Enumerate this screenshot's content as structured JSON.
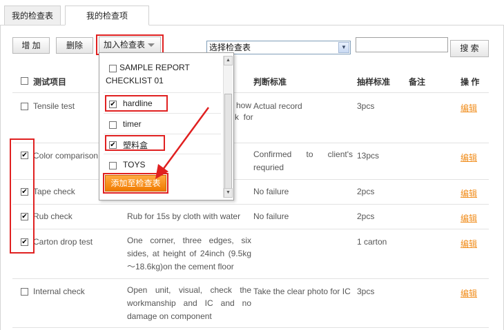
{
  "tabs": [
    "我的检查表",
    "我的检查项"
  ],
  "toolbar": {
    "add_label": "增 加",
    "delete_label": "删除",
    "add_to_checklist_label": "加入检查表",
    "select_checklist_value": "选择检查表",
    "search_label": "搜 索",
    "search_value": ""
  },
  "table": {
    "headers": [
      "测试项目",
      "判断标准",
      "抽样标准",
      "备注",
      "操 作"
    ],
    "rows": [
      {
        "name": "Tensile test",
        "method": "Pull the shoulder strap to see how many kg it can hold and check for any deformation",
        "method_visible": "how\nk  for",
        "standard": "Actual record",
        "sample": "3pcs",
        "remark": "",
        "checked": false,
        "action": "编辑"
      },
      {
        "name": "Color comparison",
        "method": "",
        "standard": "Confirmed to client's requried",
        "sample": "13pcs",
        "remark": "",
        "checked": true,
        "action": "编辑"
      },
      {
        "name": "Tape check",
        "method": "",
        "standard": "No failure",
        "sample": "2pcs",
        "remark": "",
        "checked": true,
        "action": "编辑"
      },
      {
        "name": "Rub check",
        "method": "Rub for 15s by cloth with water",
        "standard": "No failure",
        "sample": "2pcs",
        "remark": "",
        "checked": true,
        "action": "编辑"
      },
      {
        "name": "Carton drop test",
        "method": "One corner, three edges, six sides, at height of 24inch (9.5kg ～18.6kg)on the cement floor",
        "standard": "",
        "sample": "1 carton",
        "remark": "",
        "checked": true,
        "action": "编辑"
      },
      {
        "name": "Internal check",
        "method": "Open unit, visual, check the workmanship and IC and no damage on component",
        "standard": "Take the clear photo for IC",
        "sample": "3pcs",
        "remark": "",
        "checked": false,
        "action": "编辑"
      }
    ]
  },
  "dropdown": {
    "items": [
      {
        "label": "SAMPLE REPORT CHECKLIST 01",
        "checked": false
      },
      {
        "label": "hardline",
        "checked": true
      },
      {
        "label": "timer",
        "checked": false
      },
      {
        "label": "塑料盒",
        "checked": true
      },
      {
        "label": "TOYS",
        "checked": false
      }
    ],
    "add_button_label": "添加至检查表"
  },
  "colors": {
    "highlight": "#e02020",
    "accent": "#f07a00",
    "link": "#f08c1a"
  }
}
